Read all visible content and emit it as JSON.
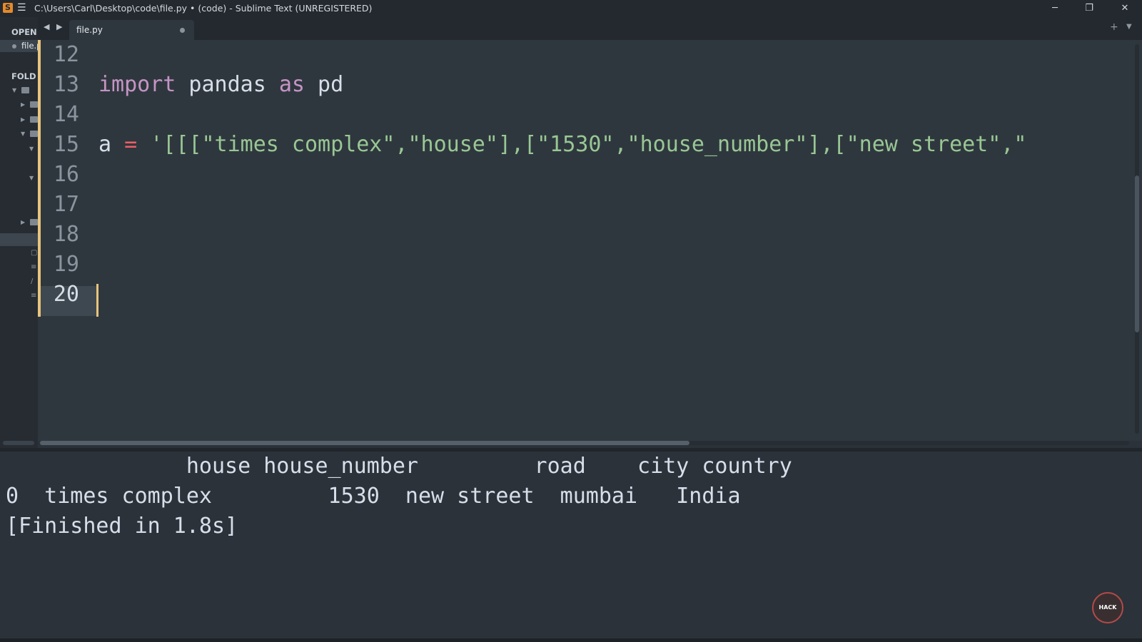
{
  "window": {
    "title": "C:\\Users\\Carl\\Desktop\\code\\file.py • (code) - Sublime Text (UNREGISTERED)",
    "app_icon": "sublime-logo",
    "controls": {
      "minimize": "─",
      "maximize": "❐",
      "close": "✕"
    }
  },
  "sidebar": {
    "open_label": "OPEN",
    "open_file": "file.p",
    "folders_label": "FOLD"
  },
  "tabs": {
    "nav": "◀ ▶",
    "active": {
      "label": "file.py",
      "modified": true
    },
    "add": "+",
    "menu": "▼"
  },
  "editor": {
    "lines": [
      {
        "num": "12",
        "segments": []
      },
      {
        "num": "13",
        "segments": [
          {
            "text": "import",
            "kind": "kw"
          },
          {
            "text": " pandas ",
            "kind": "plain"
          },
          {
            "text": "as",
            "kind": "kw"
          },
          {
            "text": " pd",
            "kind": "plain"
          }
        ]
      },
      {
        "num": "14",
        "segments": []
      },
      {
        "num": "15",
        "segments": [
          {
            "text": "a ",
            "kind": "plain"
          },
          {
            "text": "=",
            "kind": "op"
          },
          {
            "text": " '[[[\"times complex\",\"house\"],[\"1530\",\"house_number\"],[\"new street\",\"",
            "kind": "str"
          }
        ]
      },
      {
        "num": "16",
        "segments": []
      },
      {
        "num": "17",
        "segments": []
      },
      {
        "num": "18",
        "segments": []
      },
      {
        "num": "19",
        "segments": []
      },
      {
        "num": "20",
        "segments": [],
        "active": true
      }
    ]
  },
  "console": {
    "header": "              house house_number         road    city country",
    "row": "0  times complex         1530  new street  mumbai   India",
    "finished": "[Finished in 1.8s]"
  },
  "watermark": {
    "text": "HACK",
    "icon": "channel-logo"
  }
}
